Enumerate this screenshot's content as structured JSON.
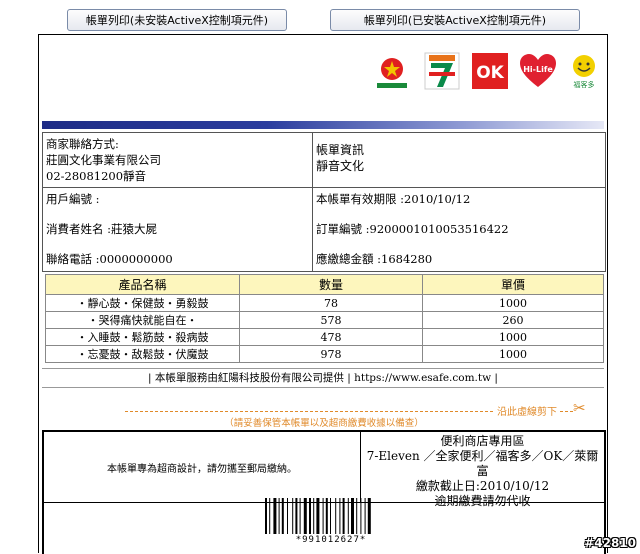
{
  "buttons": {
    "print_no_activex": "帳單列印(未安裝ActiveX控制項元件)",
    "print_with_activex": "帳單列印(已安裝ActiveX控制項元件)"
  },
  "logos": [
    {
      "name": "全家便利商店",
      "text": "全家便利商店"
    },
    {
      "name": "7-Eleven",
      "text": "ELEVEN"
    },
    {
      "name": "OK",
      "text": "OK"
    },
    {
      "name": "Hi-Life",
      "text": "Hi-Life"
    },
    {
      "name": "福客多",
      "text": "福客多"
    }
  ],
  "merchant": {
    "contact_label": "商家聯絡方式:",
    "company": "莊圓文化事業有限公司",
    "phone": "02-28081200靜音"
  },
  "bill_info": {
    "label": "帳單資訊",
    "value": "靜音文化"
  },
  "customer": {
    "account_label": "用戶編號 :",
    "name": "消費者姓名 :莊猿大屍",
    "phone": "聯絡電話 :0000000000"
  },
  "bill": {
    "valid": "本帳單有效期限 :2010/10/12",
    "order_no": "訂單編號 :9200001010053516422",
    "total": "應繳總金額 :1684280"
  },
  "items_table": {
    "headers": [
      "產品名稱",
      "數量",
      "單價"
    ],
    "rows": [
      [
        "・靜心鼓・保健鼓・勇毅鼓",
        "78",
        "1000"
      ],
      [
        "・哭得痛快就能自在・",
        "578",
        "260"
      ],
      [
        "・入睡鼓・鬆筋鼓・殺病鼓",
        "478",
        "1000"
      ],
      [
        "・忘憂鼓・敌鬆鼓・伏魔鼓",
        "978",
        "1000"
      ]
    ]
  },
  "provider": "| 本帳單服務由紅陽科技股份有限公司提供 | https://www.esafe.com.tw |",
  "cut": {
    "label": "沿此虛線剪下",
    "note": "（請妥善保管本帳單以及超商繳費收據以備查）"
  },
  "store": {
    "left_text": "本帳單專為超商設計，請勿攜至郵局繳納。",
    "title": "便利商店專用區",
    "stores": "7-Eleven ／全家便利／福客多／OK／萊爾富",
    "deadline": "繳款截止日:2010/10/12",
    "overdue": "逾期繳費請勿代收"
  },
  "barcode_text": "*991012627*",
  "watermark": "#42810",
  "colors": {
    "accent_orange": "#e08a2a",
    "header_yellow": "#fdf6bd",
    "bar_blue": "#1e2c86"
  }
}
